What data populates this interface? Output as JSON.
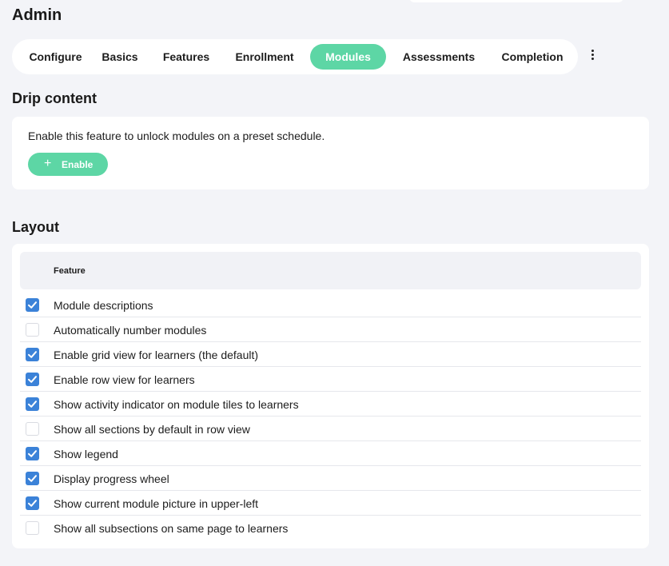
{
  "title": "Admin",
  "tabs": [
    {
      "label": "Configure",
      "active": false
    },
    {
      "label": "Basics",
      "active": false
    },
    {
      "label": "Features",
      "active": false
    },
    {
      "label": "Enrollment",
      "active": false
    },
    {
      "label": "Modules",
      "active": true
    },
    {
      "label": "Assessments",
      "active": false
    },
    {
      "label": "Completion",
      "active": false
    }
  ],
  "more_icon": "more-vertical-icon",
  "drip": {
    "heading": "Drip content",
    "description": "Enable this feature to unlock modules on a preset schedule.",
    "button_icon": "plus-icon",
    "button_label": "Enable"
  },
  "layout": {
    "heading": "Layout",
    "column_header": "Feature",
    "rows": [
      {
        "label": "Module descriptions",
        "checked": true
      },
      {
        "label": "Automatically number modules",
        "checked": false
      },
      {
        "label": "Enable grid view for learners (the default)",
        "checked": true
      },
      {
        "label": "Enable row view for learners",
        "checked": true
      },
      {
        "label": "Show activity indicator on module tiles to learners",
        "checked": true
      },
      {
        "label": "Show all sections by default in row view",
        "checked": false
      },
      {
        "label": "Show legend",
        "checked": true
      },
      {
        "label": "Display progress wheel",
        "checked": true
      },
      {
        "label": "Show current module picture in upper-left",
        "checked": true
      },
      {
        "label": "Show all subsections on same page to learners",
        "checked": false
      }
    ]
  },
  "colors": {
    "accent": "#5dd6a5",
    "checkbox": "#3b82d8",
    "background": "#f3f4f8"
  }
}
